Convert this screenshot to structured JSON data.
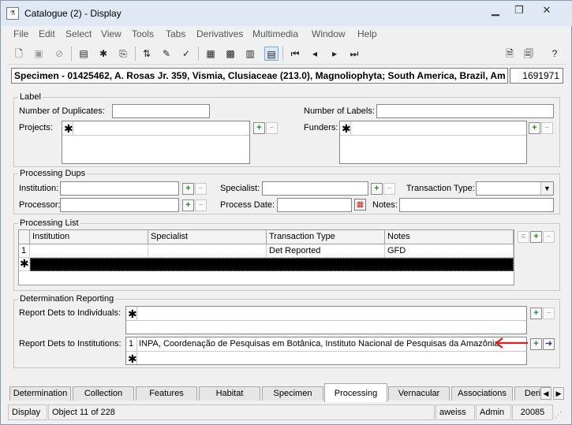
{
  "window": {
    "title": "Catalogue (2) - Display",
    "icon_label": "lab",
    "minimize_icon": "minimize-icon",
    "restore_icon": "restore-icon",
    "close_icon": "close-icon"
  },
  "menu": [
    "File",
    "Edit",
    "Select",
    "View",
    "Tools",
    "Tabs",
    "Derivatives",
    "Multimedia",
    "Window",
    "Help"
  ],
  "record": {
    "summary": "Specimen - 01425462, A. Rosas Jr. 359, Vismia, Clusiaceae (213.0), Magnoliophyta;  South America, Brazil, Am",
    "id": "1691971"
  },
  "label_group": {
    "legend": "Label",
    "duplicates_label": "Number of Duplicates:",
    "duplicates_value": "",
    "labels_label": "Number of Labels:",
    "labels_value": "",
    "projects_label": "Projects:",
    "funders_label": "Funders:",
    "star": "✱"
  },
  "dups_group": {
    "legend": "Processing Dups",
    "institution_label": "Institution:",
    "specialist_label": "Specialist:",
    "transaction_label": "Transaction Type:",
    "processor_label": "Processor:",
    "process_date_label": "Process Date:",
    "notes_label": "Notes:"
  },
  "list_group": {
    "legend": "Processing List",
    "columns": [
      "Institution",
      "Specialist",
      "Transaction Type",
      "Notes"
    ],
    "rows": [
      {
        "num": "1",
        "institution": "",
        "specialist": "",
        "transaction": "Det Reported",
        "notes": "GFD"
      }
    ],
    "new_row_marker": "✱"
  },
  "det_group": {
    "legend": "Determination Reporting",
    "individuals_label": "Report Dets to Individuals:",
    "institutions_label": "Report Dets to Institutions:",
    "inst_row_num": "1",
    "inst_row_value": "INPA, Coordenação de Pesquisas em Botânica, Instituto Nacional de Pesquisas da Amazônia",
    "star": "✱"
  },
  "tabs": [
    "Determination",
    "Collection",
    "Features",
    "Habitat",
    "Specimen",
    "Processing",
    "Vernacular",
    "Associations",
    "Deri"
  ],
  "active_tab": "Processing",
  "status": {
    "mode": "Display",
    "object": "Object 11 of 228",
    "user": "aweiss",
    "role": "Admin",
    "code": "20085"
  },
  "colors": {
    "annotation_arrow": "#e0201c",
    "add_button": "#1d8a1d"
  }
}
